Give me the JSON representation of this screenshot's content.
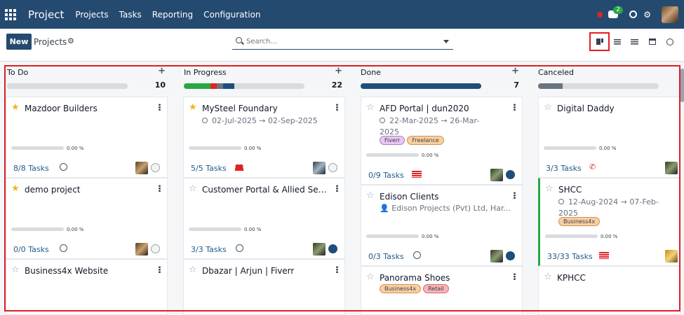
{
  "nav": {
    "brand": "Project",
    "menu": [
      "Projects",
      "Tasks",
      "Reporting",
      "Configuration"
    ],
    "chat_badge": "2"
  },
  "control": {
    "new_label": "New",
    "breadcrumb": "Projects",
    "search_placeholder": "Search..."
  },
  "views": [
    "kanban",
    "list",
    "activity",
    "calendar",
    "activity-clock"
  ],
  "columns": [
    {
      "title": "To Do",
      "count": "10",
      "cards": [
        {
          "name": "Mazdoor Builders",
          "starred": true,
          "pct": "0.00 %",
          "tasks": "8/8 Tasks",
          "activity": "clock",
          "state": "grey"
        },
        {
          "name": "demo project",
          "starred": true,
          "pct": "0.00 %",
          "tasks": "0/0 Tasks",
          "activity": "clock",
          "state": "grey"
        },
        {
          "name": "Business4x Website",
          "starred": false
        }
      ]
    },
    {
      "title": "In Progress",
      "count": "22",
      "cards": [
        {
          "name": "MySteel Foundary",
          "starred": true,
          "date_line": "02-Jul-2025 → 02-Sep-2025",
          "pct": "0.00 %",
          "tasks": "5/5 Tasks",
          "activity": "users",
          "state": "grey"
        },
        {
          "name": "Customer Portal & Allied Servi...",
          "starred": false,
          "pct": "0.00 %",
          "tasks": "3/3 Tasks",
          "activity": "clock",
          "state": "blue"
        },
        {
          "name": "Dbazar | Arjun | Fiverr",
          "starred": false
        }
      ]
    },
    {
      "title": "Done",
      "count": "7",
      "cards": [
        {
          "name": "AFD Portal | dun2020",
          "starred": false,
          "date_line": "22-Mar-2025 → 26-Mar-2025",
          "tags": [
            "Fiverr",
            "Freelance"
          ],
          "pct": "0.00 %",
          "tasks": "0/9 Tasks",
          "activity": "flag",
          "state": "blue"
        },
        {
          "name": "Edison Clients",
          "starred": false,
          "partner": "Edison Projects (Pvt) Ltd, Har...",
          "pct": "0.00 %",
          "tasks": "0/3 Tasks",
          "activity": "clock",
          "state": "blue"
        },
        {
          "name": "Panorama Shoes",
          "starred": false,
          "tags": [
            "Business4x",
            "Retail"
          ]
        }
      ]
    },
    {
      "title": "Canceled",
      "count": "",
      "cards": [
        {
          "name": "Digital Daddy",
          "starred": false,
          "pct": "0.00 %",
          "tasks": "3/3 Tasks",
          "activity": "phone"
        },
        {
          "name": "SHCC",
          "starred": false,
          "date_line": "12-Aug-2024 → 07-Feb-2025",
          "tags": [
            "Business4x"
          ],
          "pct": "0.00 %",
          "tasks": "33/33 Tasks",
          "activity": "flag"
        },
        {
          "name": "KPHCC",
          "starred": false
        }
      ]
    }
  ],
  "colors": {
    "nav": "#244a70",
    "highlight": "#e01e25",
    "link": "#1f5a8b"
  }
}
